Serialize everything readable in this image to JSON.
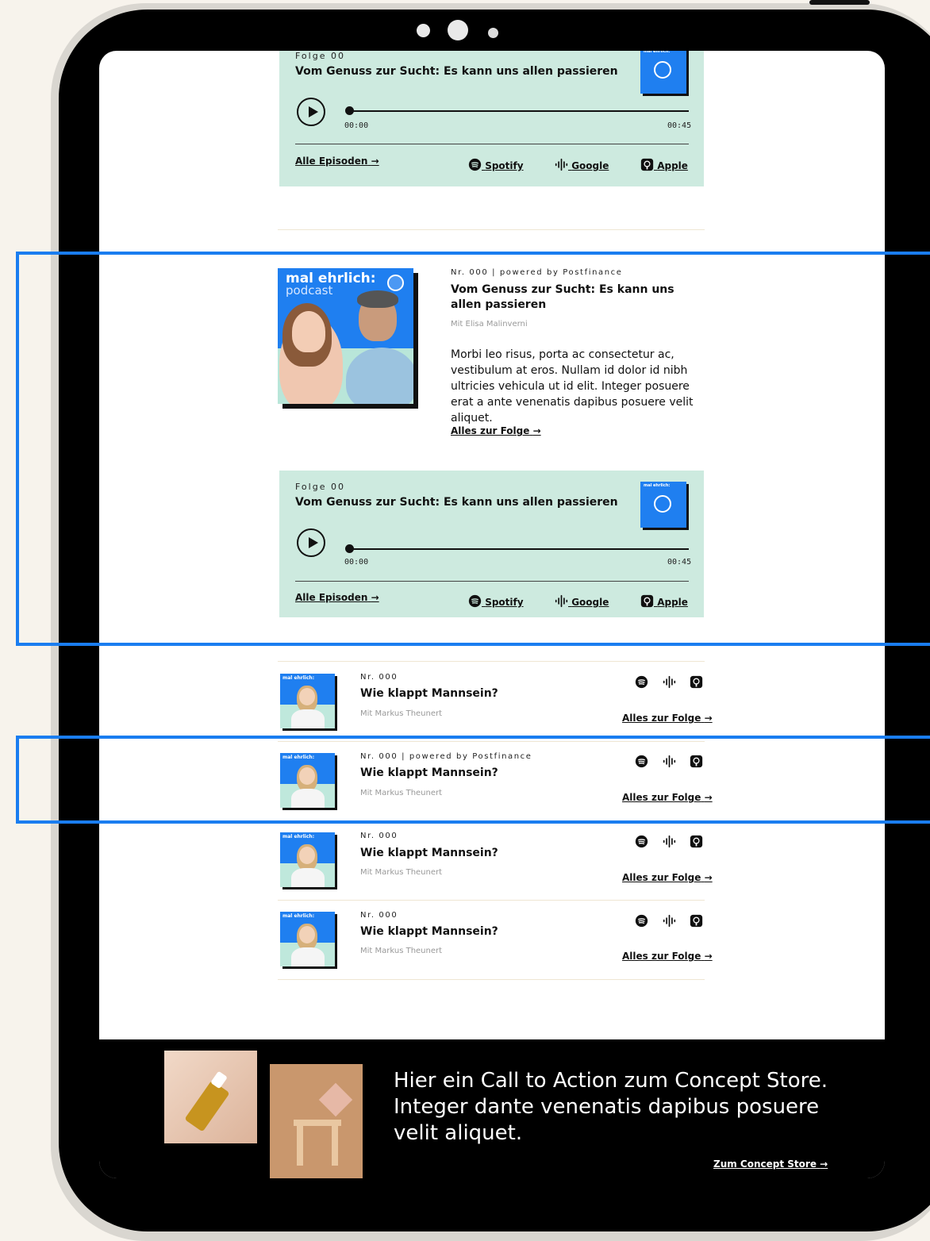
{
  "player_top": {
    "label": "Folge 00",
    "title": "Vom Genuss zur Sucht: Es kann uns allen passieren",
    "time_start": "00:00",
    "time_end": "00:45",
    "all_episodes": "Alle Episoden",
    "arrow": "→",
    "spotify": "Spotify",
    "google": "Google",
    "apple": "Apple"
  },
  "featured": {
    "brand_line1": "mal ehrlich:",
    "brand_line2": "podcast",
    "meta": "Nr. 000 | powered by Postfinance",
    "title": "Vom Genuss zur Sucht: Es kann uns allen passieren",
    "with": "Mit Elisa Malinverni",
    "description": "Morbi leo risus, porta ac consectetur ac, vestibulum at eros. Nullam id dolor id nibh ultricies vehicula ut id elit. Integer posuere erat a ante venenatis dapibus posuere velit aliquet.",
    "more": "Alles zur Folge",
    "arrow": "→"
  },
  "player_featured": {
    "label": "Folge 00",
    "title": "Vom Genuss zur Sucht: Es kann uns allen passieren",
    "time_start": "00:00",
    "time_end": "00:45",
    "all_episodes": "Alle Episoden",
    "arrow": "→",
    "spotify": "Spotify",
    "google": "Google",
    "apple": "Apple"
  },
  "episodes": [
    {
      "thumb": "mal ehrlich:",
      "meta": "Nr. 000",
      "title": "Wie klappt Mannsein?",
      "with": "Mit Markus Theunert",
      "more": "Alles zur Folge",
      "arrow": "→"
    },
    {
      "thumb": "mal ehrlich:",
      "meta": "Nr. 000 | powered by Postfinance",
      "title": "Wie klappt Mannsein?",
      "with": "Mit Markus Theunert",
      "more": "Alles zur Folge",
      "arrow": "→"
    },
    {
      "thumb": "mal ehrlich:",
      "meta": "Nr. 000",
      "title": "Wie klappt Mannsein?",
      "with": "Mit Markus Theunert",
      "more": "Alles zur Folge",
      "arrow": "→"
    },
    {
      "thumb": "mal ehrlich:",
      "meta": "Nr. 000",
      "title": "Wie klappt Mannsein?",
      "with": "Mit Markus Theunert",
      "more": "Alles zur Folge",
      "arrow": "→"
    }
  ],
  "cta": {
    "text": "Hier ein Call to Action zum Concept Store. Integer dante venenatis dapibus posuere velit aliquet.",
    "link": "Zum Concept Store",
    "arrow": "→"
  },
  "colors": {
    "player_bg": "#cdeadf",
    "brand_blue": "#1f7ff0",
    "highlight": "#1a7df0",
    "cta_bg": "#000000"
  },
  "icons": [
    "play-icon",
    "spotify-icon",
    "google-podcasts-icon",
    "apple-podcasts-icon",
    "arrow-right-icon",
    "podcast-mic-icon"
  ]
}
